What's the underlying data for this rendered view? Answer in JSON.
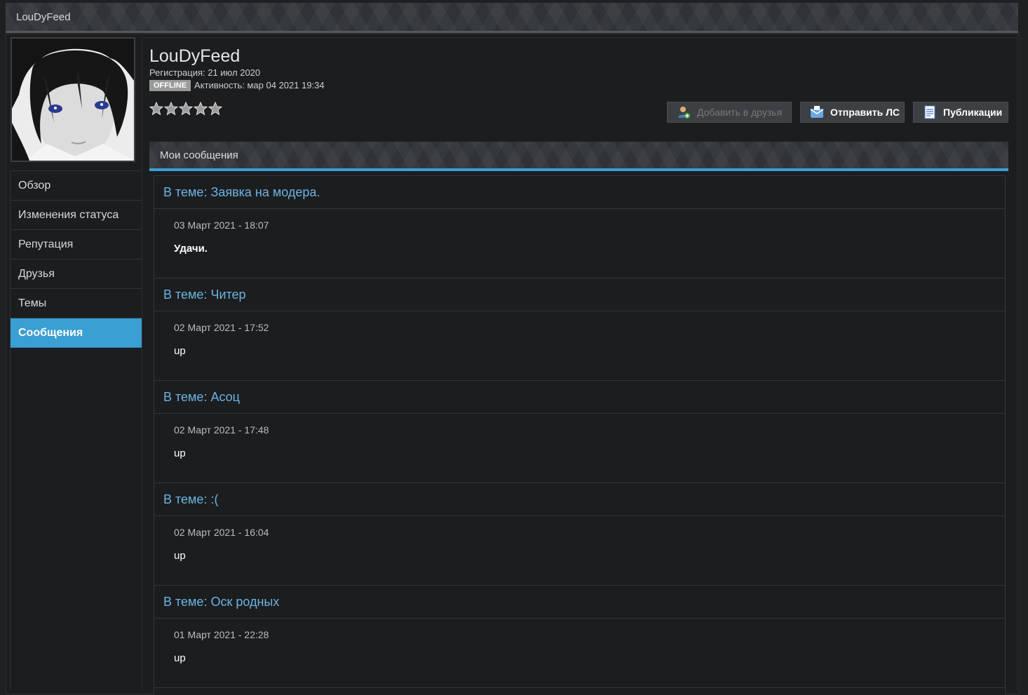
{
  "window": {
    "title": "LouDyFeed"
  },
  "profile": {
    "username": "LouDyFeed",
    "registration": "Регистрация: 21 июл 2020",
    "status_badge": "OFFLINE",
    "activity": "Активность: мар 04 2021 19:34",
    "rating_stars": 5
  },
  "actions": {
    "add_friend": "Добавить в друзья",
    "send_pm": "Отправить ЛС",
    "publications": "Публикации"
  },
  "sidebar": {
    "items": [
      {
        "label": "Обзор"
      },
      {
        "label": "Изменения статуса"
      },
      {
        "label": "Репутация"
      },
      {
        "label": "Друзья"
      },
      {
        "label": "Темы"
      },
      {
        "label": "Сообщения",
        "active": true
      }
    ]
  },
  "section": {
    "title": "Мои сообщения"
  },
  "posts": [
    {
      "topic": "В теме: Заявка на модера.",
      "date": "03 Март 2021 - 18:07",
      "text": "Удачи."
    },
    {
      "topic": "В теме: Читер",
      "date": "02 Март 2021 - 17:52",
      "text": "up"
    },
    {
      "topic": "В теме: Асоц",
      "date": "02 Март 2021 - 17:48",
      "text": "up"
    },
    {
      "topic": "В теме: :(",
      "date": "02 Март 2021 - 16:04",
      "text": "up"
    },
    {
      "topic": "В теме: Оск родных",
      "date": "01 Март 2021 - 22:28",
      "text": "up"
    }
  ],
  "colors": {
    "accent": "#3a9fd2",
    "link": "#6cb3e3",
    "background": "#1c1d1f"
  }
}
